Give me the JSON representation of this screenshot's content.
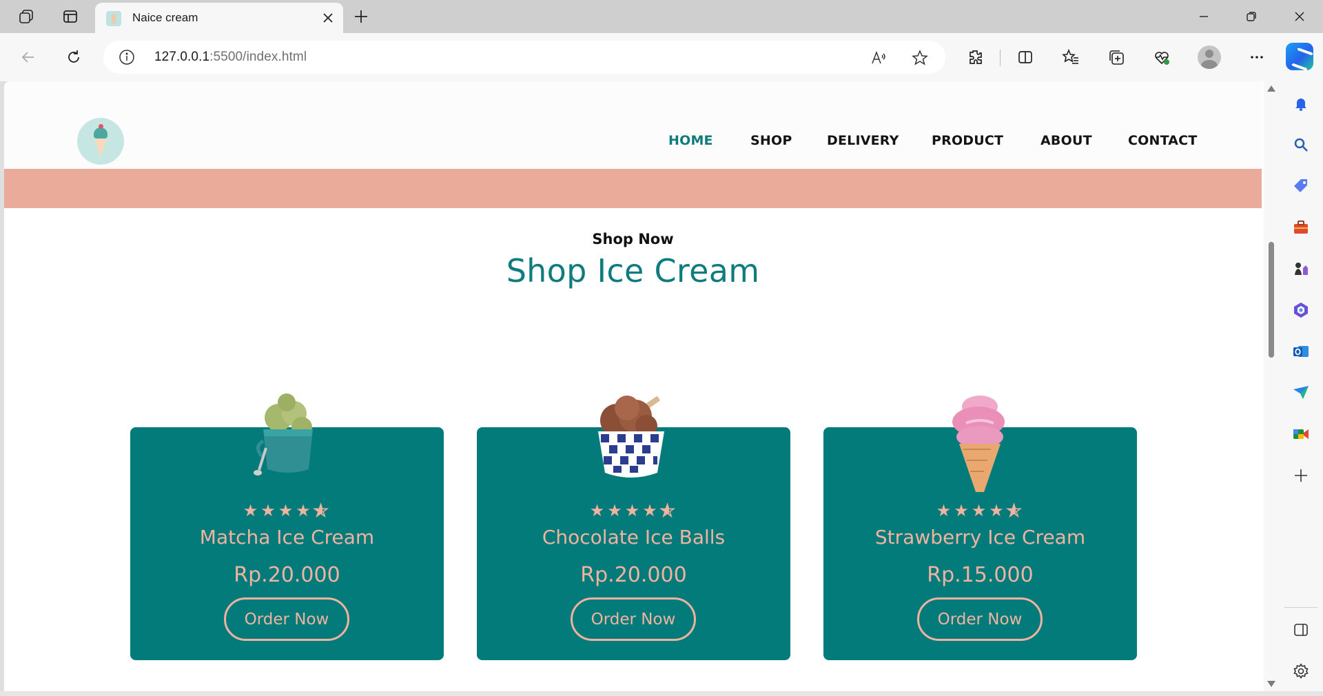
{
  "browser": {
    "tab_title": "Naice cream",
    "url_host": "127.0.0.1",
    "url_rest": ":5500/index.html"
  },
  "site": {
    "nav": [
      {
        "label": "HOME",
        "active": true
      },
      {
        "label": "SHOP",
        "active": false
      },
      {
        "label": "DELIVERY",
        "active": false
      },
      {
        "label": "PRODUCT",
        "active": false
      },
      {
        "label": "ABOUT",
        "active": false
      },
      {
        "label": "CONTACT",
        "active": false
      }
    ],
    "section_subtitle": "Shop Now",
    "section_title": "Shop Ice Cream",
    "products": [
      {
        "name": "Matcha Ice Cream",
        "price": "Rp.20.000",
        "rating": 4.5,
        "button": "Order Now"
      },
      {
        "name": "Chocolate Ice Balls",
        "price": "Rp.20.000",
        "rating": 4.5,
        "button": "Order Now"
      },
      {
        "name": "Strawberry Ice Cream",
        "price": "Rp.15.000",
        "rating": 4.5,
        "button": "Order Now"
      }
    ]
  },
  "colors": {
    "accent_teal": "#0e7b7d",
    "card_teal": "#047b7b",
    "peach": "#f0b3a0",
    "band_pink": "#eaab9b"
  }
}
